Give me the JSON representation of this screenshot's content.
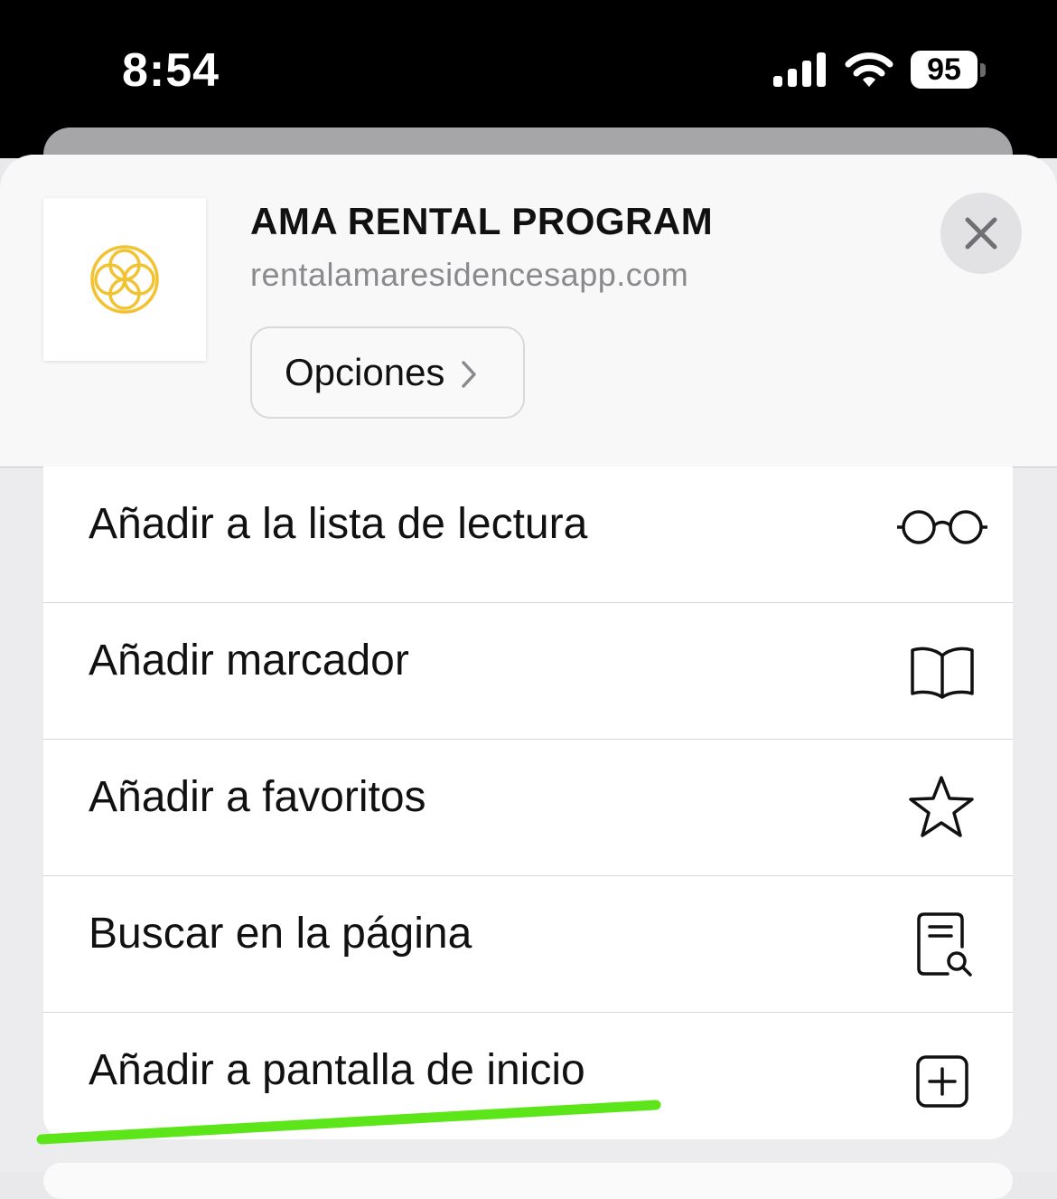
{
  "status_bar": {
    "time": "8:54",
    "battery": "95",
    "icons": [
      "cellular-signal-icon",
      "wifi-icon",
      "battery-icon"
    ]
  },
  "header": {
    "title": "AMA RENTAL PROGRAM",
    "url": "rentalamaresidencesapp.com",
    "options_label": "Opciones",
    "icons": [
      "site-logo-icon",
      "chevron-right-icon",
      "close-icon"
    ],
    "logo_color": "#F2C230"
  },
  "menu": {
    "items": [
      {
        "label": "Añadir a la lista de lectura",
        "icon": "glasses-icon"
      },
      {
        "label": "Añadir marcador",
        "icon": "book-icon"
      },
      {
        "label": "Añadir a favoritos",
        "icon": "star-icon"
      },
      {
        "label": "Buscar en la página",
        "icon": "find-in-page-icon"
      },
      {
        "label": "Añadir a pantalla de inicio",
        "icon": "add-square-icon"
      }
    ]
  },
  "colors": {
    "highlight": "#5CE619",
    "status_bar_bg": "#000000",
    "secondary_text": "#8A8A8E"
  }
}
